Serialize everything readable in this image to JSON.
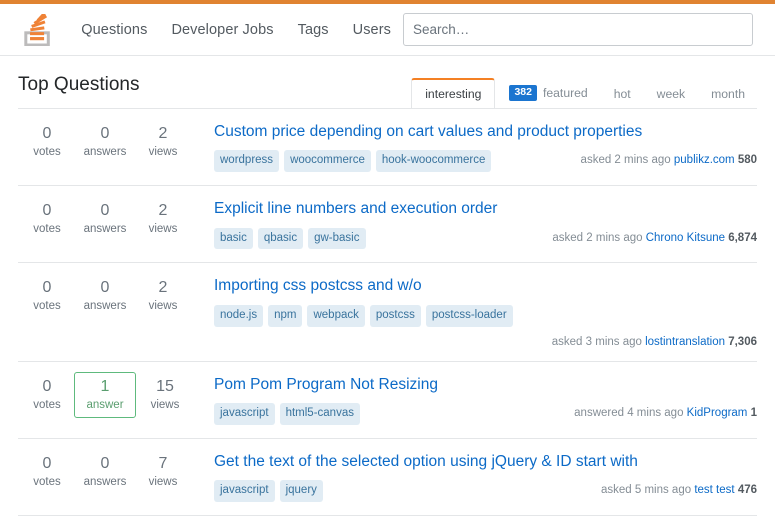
{
  "colors": {
    "accent_orange": "#e08331",
    "tab_active_border": "#f48024",
    "link_blue": "#0c6ac7",
    "badge_blue": "#1b75d0",
    "answered_green": "#5eba7d",
    "tag_bg": "#e1ecf4",
    "tag_text": "#39739d"
  },
  "header": {
    "logo_name": "stack-overflow-logo",
    "nav": [
      {
        "label": "Questions",
        "name": "nav-questions"
      },
      {
        "label": "Developer Jobs",
        "name": "nav-developer-jobs"
      },
      {
        "label": "Tags",
        "name": "nav-tags"
      },
      {
        "label": "Users",
        "name": "nav-users"
      }
    ],
    "search": {
      "placeholder": "Search…",
      "value": ""
    }
  },
  "main": {
    "page_title": "Top Questions",
    "tabs": [
      {
        "label": "interesting",
        "active": true,
        "badge": null
      },
      {
        "label": "featured",
        "active": false,
        "badge": "382"
      },
      {
        "label": "hot",
        "active": false,
        "badge": null
      },
      {
        "label": "week",
        "active": false,
        "badge": null
      },
      {
        "label": "month",
        "active": false,
        "badge": null
      }
    ],
    "stat_labels": {
      "votes": "votes",
      "answers": "answers",
      "answer_singular": "answer",
      "views": "views"
    },
    "questions": [
      {
        "votes": "0",
        "answers": "0",
        "answers_label": "answers",
        "answered": false,
        "views": "2",
        "title": "Custom price depending on cart values and product properties",
        "tags": [
          "wordpress",
          "woocommerce",
          "hook-woocommerce"
        ],
        "meta_action": "asked 2 mins ago",
        "meta_user": "publikz.com",
        "meta_rep": "580",
        "meta_wraps": false
      },
      {
        "votes": "0",
        "answers": "0",
        "answers_label": "answers",
        "answered": false,
        "views": "2",
        "title": "Explicit line numbers and execution order",
        "tags": [
          "basic",
          "qbasic",
          "gw-basic"
        ],
        "meta_action": "asked 2 mins ago",
        "meta_user": "Chrono Kitsune",
        "meta_rep": "6,874",
        "meta_wraps": false
      },
      {
        "votes": "0",
        "answers": "0",
        "answers_label": "answers",
        "answered": false,
        "views": "2",
        "title": "Importing css postcss and w/o",
        "tags": [
          "node.js",
          "npm",
          "webpack",
          "postcss",
          "postcss-loader"
        ],
        "meta_action": "asked 3 mins ago",
        "meta_user": "lostintranslation",
        "meta_rep": "7,306",
        "meta_wraps": true
      },
      {
        "votes": "0",
        "answers": "1",
        "answers_label": "answer",
        "answered": true,
        "views": "15",
        "title": "Pom Pom Program Not Resizing",
        "tags": [
          "javascript",
          "html5-canvas"
        ],
        "meta_action": "answered 4 mins ago",
        "meta_user": "KidProgram",
        "meta_rep": "1",
        "meta_wraps": false
      },
      {
        "votes": "0",
        "answers": "0",
        "answers_label": "answers",
        "answered": false,
        "views": "7",
        "title": "Get the text of the selected option using jQuery & ID start with",
        "tags": [
          "javascript",
          "jquery"
        ],
        "meta_action": "asked 5 mins ago",
        "meta_user": "test test",
        "meta_rep": "476",
        "meta_wraps": false
      }
    ]
  }
}
